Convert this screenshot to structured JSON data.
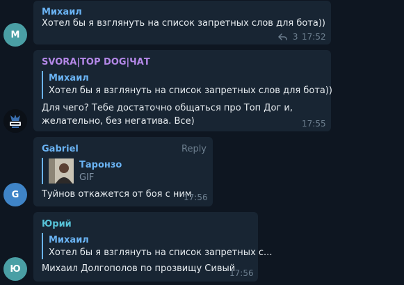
{
  "messages": [
    {
      "avatar": "М",
      "sender": "Михаил",
      "text": "Хотел бы я взглянуть на список запретных слов для бота))",
      "replies_count": "3",
      "time": "17:52"
    },
    {
      "avatar_icon": "svora-logo",
      "sender": "SVORA|TOP DOG|ЧАТ",
      "quote_name": "Михаил",
      "quote_text": "Хотел бы я взглянуть на список запретных слов для бота))",
      "text_line1": "Для чего? Тебе достаточно общаться про Топ Дог и,",
      "text_line2": "желательно, без негатива. Все)",
      "time": "17:55"
    },
    {
      "avatar": "G",
      "sender": "Gabriel",
      "reply_label": "Reply",
      "quote_name": "Таронзо",
      "quote_text": "GIF",
      "text": "Туйнов откажется от боя с ним",
      "time": "17:56"
    },
    {
      "avatar": "Ю",
      "sender": "Юрий",
      "quote_name": "Михаил",
      "quote_text": "Хотел бы я взглянуть на список запретных с...",
      "text": "Михаил Долгополов по прозвищу Сивый",
      "time": "17:56"
    }
  ],
  "colors": {
    "background": "#0e1621",
    "bubble": "#182533",
    "sender_blue": "#6ab3f3",
    "sender_purple": "#b488e8",
    "sender_cyan": "#57c3d8"
  }
}
